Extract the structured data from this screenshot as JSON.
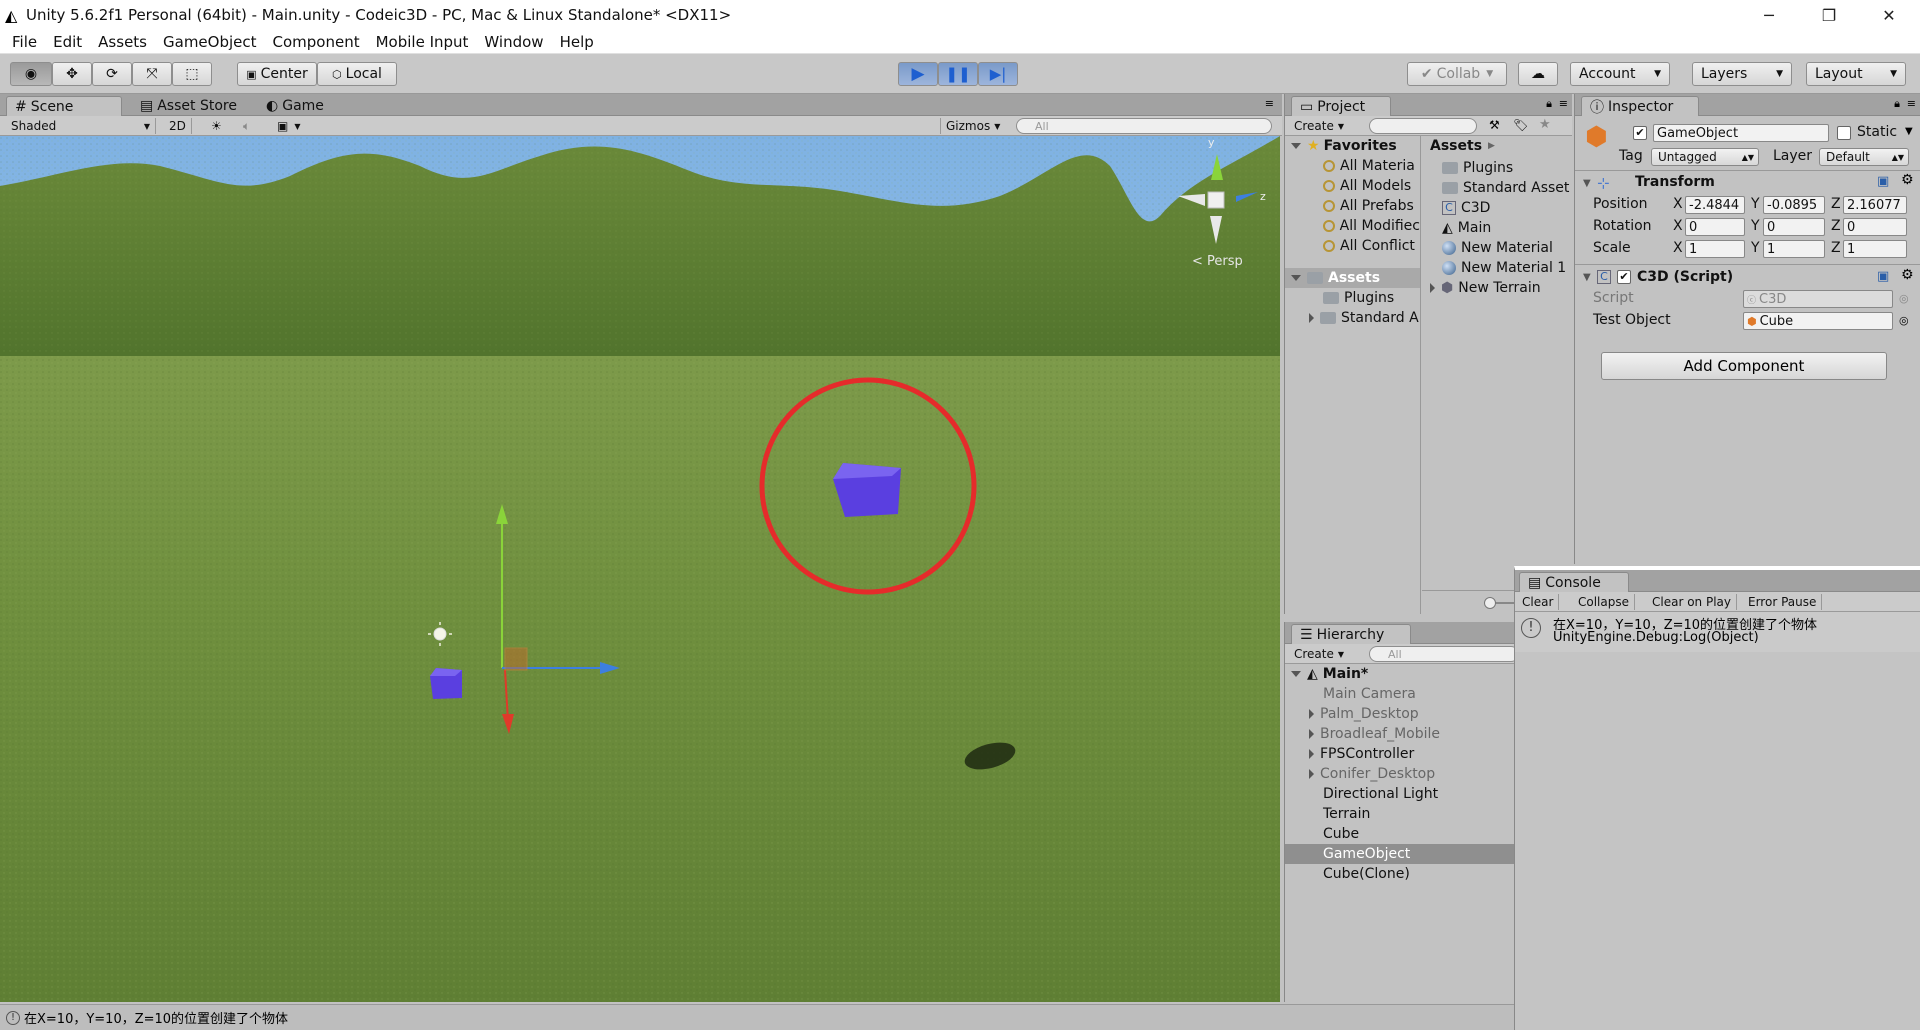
{
  "window": {
    "title": "Unity 5.6.2f1 Personal (64bit) - Main.unity - Codeic3D - PC, Mac & Linux Standalone* <DX11>",
    "minimize": "─",
    "maximize": "❐",
    "close": "✕"
  },
  "menu": [
    "File",
    "Edit",
    "Assets",
    "GameObject",
    "Component",
    "Mobile Input",
    "Window",
    "Help"
  ],
  "toolbar": {
    "center": "Center",
    "local": "Local",
    "collab": "Collab",
    "account": "Account",
    "layers": "Layers",
    "layout": "Layout"
  },
  "scene": {
    "tabs": [
      "Scene",
      "Asset Store",
      "Game"
    ],
    "shaded": "Shaded",
    "mode2d": "2D",
    "gizmos": "Gizmos",
    "search_placeholder": "All",
    "persp": "Persp",
    "axis_y": "y",
    "axis_z": "z"
  },
  "project": {
    "tab": "Project",
    "create": "Create",
    "favorites_label": "Favorites",
    "favorites": [
      "All Materia",
      "All Models",
      "All Prefabs",
      "All Modifiec",
      "All Conflict"
    ],
    "assets_label": "Assets",
    "tree": [
      "Plugins",
      "Standard A"
    ],
    "assets_header": "Assets",
    "assets": [
      "Plugins",
      "Standard Asset",
      "C3D",
      "Main",
      "New Material",
      "New Material 1",
      "New Terrain"
    ]
  },
  "hierarchy": {
    "tab": "Hierarchy",
    "create": "Create",
    "search_placeholder": "All",
    "scene": "Main*",
    "items": [
      "Main Camera",
      "Palm_Desktop",
      "Broadleaf_Mobile",
      "FPSController",
      "Conifer_Desktop",
      "Directional Light",
      "Terrain",
      "Cube",
      "GameObject",
      "Cube(Clone)"
    ],
    "selected": "GameObject"
  },
  "inspector": {
    "tab": "Inspector",
    "name": "GameObject",
    "static": "Static",
    "tag_label": "Tag",
    "tag": "Untagged",
    "layer_label": "Layer",
    "layer": "Default",
    "transform": "Transform",
    "position_label": "Position",
    "position": {
      "x": "-2.4844",
      "y": "-0.0895",
      "z": "2.16077"
    },
    "rotation_label": "Rotation",
    "rotation": {
      "x": "0",
      "y": "0",
      "z": "0"
    },
    "scale_label": "Scale",
    "scale": {
      "x": "1",
      "y": "1",
      "z": "1"
    },
    "component": "C3D (Script)",
    "script_label": "Script",
    "script": "C3D",
    "test_label": "Test Object",
    "test_value": "Cube",
    "add_component": "Add Component",
    "x": "X",
    "y": "Y",
    "z": "Z"
  },
  "console": {
    "tab": "Console",
    "buttons": [
      "Clear",
      "Collapse",
      "Clear on Play",
      "Error Pause"
    ],
    "line1": "在X=10，Y=10，Z=10的位置创建了个物体",
    "line2": "UnityEngine.Debug:Log(Object)"
  },
  "statusbar": {
    "text": "在X=10，Y=10，Z=10的位置创建了个物体"
  },
  "colors": {
    "play_blue": "#2f6fd6",
    "cube": "#5a3fe0",
    "highlight_circle": "#e52b2b"
  }
}
